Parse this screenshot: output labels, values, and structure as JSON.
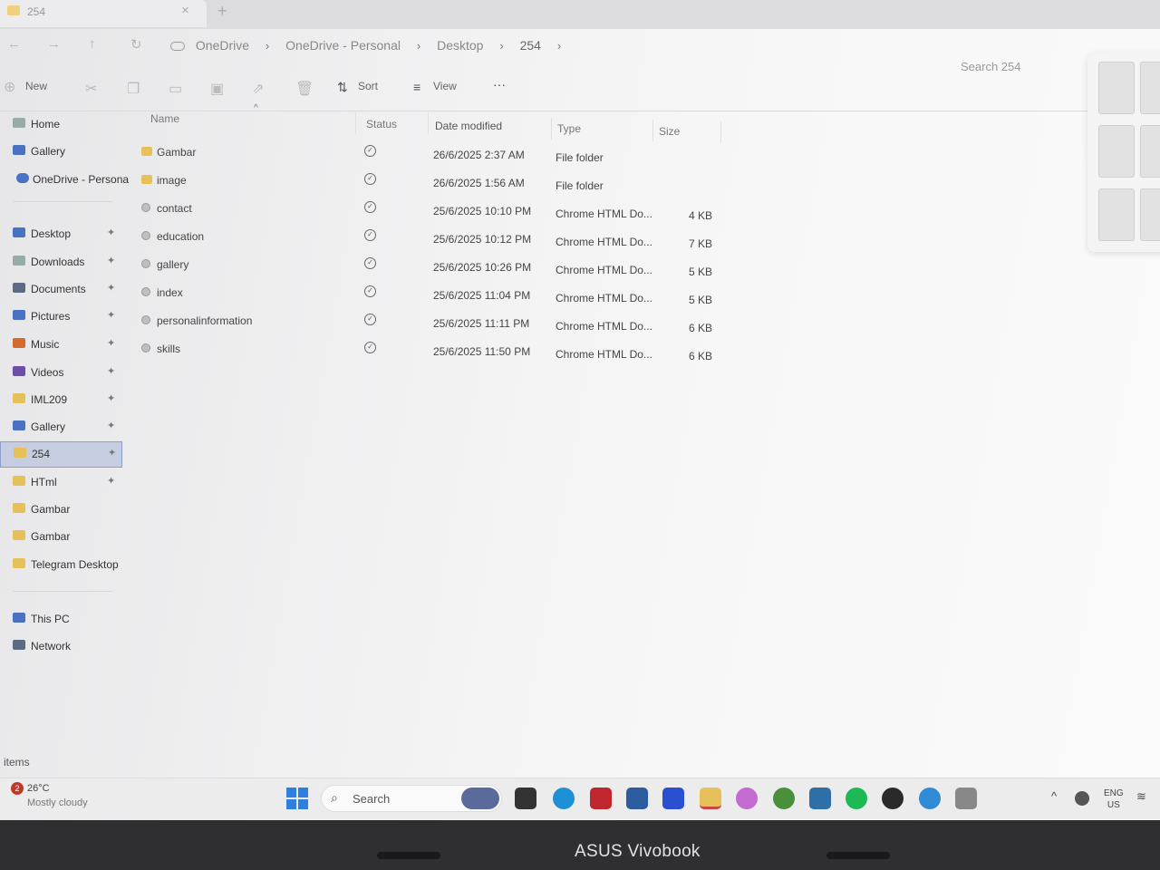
{
  "window": {
    "tab_title": "254",
    "tab_close": "×",
    "new_tab": "+"
  },
  "nav": {
    "back": "←",
    "forward": "→",
    "up": "↑",
    "refresh": "↻"
  },
  "breadcrumb": {
    "items": [
      "OneDrive",
      "OneDrive - Personal",
      "Desktop",
      "254"
    ],
    "separator": "›"
  },
  "search": {
    "placeholder": "Search 254"
  },
  "toolbar": {
    "new_label": "New",
    "sort_label": "Sort",
    "view_label": "View",
    "more_label": "···"
  },
  "sidebar": {
    "top_items": [
      {
        "label": "Home",
        "icon": "home-icon"
      },
      {
        "label": "Gallery",
        "icon": "gallery-icon"
      },
      {
        "label": "OneDrive - Persona",
        "icon": "onedrive-icon"
      }
    ],
    "quick_access": [
      {
        "label": "Desktop",
        "icon": "desktop-icon",
        "pinned": true
      },
      {
        "label": "Downloads",
        "icon": "download-icon",
        "pinned": true
      },
      {
        "label": "Documents",
        "icon": "documents-icon",
        "pinned": true
      },
      {
        "label": "Pictures",
        "icon": "pictures-icon",
        "pinned": true
      },
      {
        "label": "Music",
        "icon": "music-icon",
        "pinned": true
      },
      {
        "label": "Videos",
        "icon": "videos-icon",
        "pinned": true
      },
      {
        "label": "IML209",
        "icon": "folder-icon",
        "pinned": true
      },
      {
        "label": "Gallery",
        "icon": "gallery-icon",
        "pinned": true
      },
      {
        "label": "254",
        "icon": "folder-icon",
        "pinned": true,
        "selected": true
      },
      {
        "label": "HTml",
        "icon": "folder-icon",
        "pinned": true
      },
      {
        "label": "Gambar",
        "icon": "folder-icon",
        "pinned": false
      },
      {
        "label": "Gambar",
        "icon": "folder-icon",
        "pinned": false
      },
      {
        "label": "Telegram Desktop",
        "icon": "folder-icon",
        "pinned": false
      }
    ],
    "bottom_items": [
      {
        "label": "This PC",
        "icon": "pc-icon"
      },
      {
        "label": "Network",
        "icon": "network-icon"
      }
    ],
    "pin_glyph": "📌"
  },
  "columns": {
    "name": "Name",
    "status": "Status",
    "date": "Date modified",
    "type": "Type",
    "size": "Size"
  },
  "files": [
    {
      "name": "Gambar",
      "kind": "folder",
      "date": "26/6/2025 2:37 AM",
      "type": "File folder",
      "size": ""
    },
    {
      "name": "image",
      "kind": "folder",
      "date": "26/6/2025 1:56 AM",
      "type": "File folder",
      "size": ""
    },
    {
      "name": "contact",
      "kind": "html",
      "date": "25/6/2025 10:10 PM",
      "type": "Chrome HTML Do...",
      "size": "4 KB"
    },
    {
      "name": "education",
      "kind": "html",
      "date": "25/6/2025 10:12 PM",
      "type": "Chrome HTML Do...",
      "size": "7 KB"
    },
    {
      "name": "gallery",
      "kind": "html",
      "date": "25/6/2025 10:26 PM",
      "type": "Chrome HTML Do...",
      "size": "5 KB"
    },
    {
      "name": "index",
      "kind": "html",
      "date": "25/6/2025 11:04 PM",
      "type": "Chrome HTML Do...",
      "size": "5 KB"
    },
    {
      "name": "personalinformation",
      "kind": "html",
      "date": "25/6/2025 11:11 PM",
      "type": "Chrome HTML Do...",
      "size": "6 KB"
    },
    {
      "name": "skills",
      "kind": "html",
      "date": "25/6/2025 11:50 PM",
      "type": "Chrome HTML Do...",
      "size": "6 KB"
    }
  ],
  "status_glyph": "✓",
  "statusbar": {
    "text": "items"
  },
  "taskbar": {
    "weather_badge": "2",
    "weather_temp": "26°C",
    "weather_desc": "Mostly cloudy",
    "search_label": "Search",
    "search_icon": "⌕",
    "lang_top": "ENG",
    "lang_bottom": "US",
    "chevron": "^",
    "wifi": "≋"
  },
  "bezel": {
    "brand": "ASUS Vivobook"
  },
  "colors": {
    "accent": "#2f7fe0",
    "folder": "#e6c15a",
    "selected_bg": "#c6cde0"
  }
}
